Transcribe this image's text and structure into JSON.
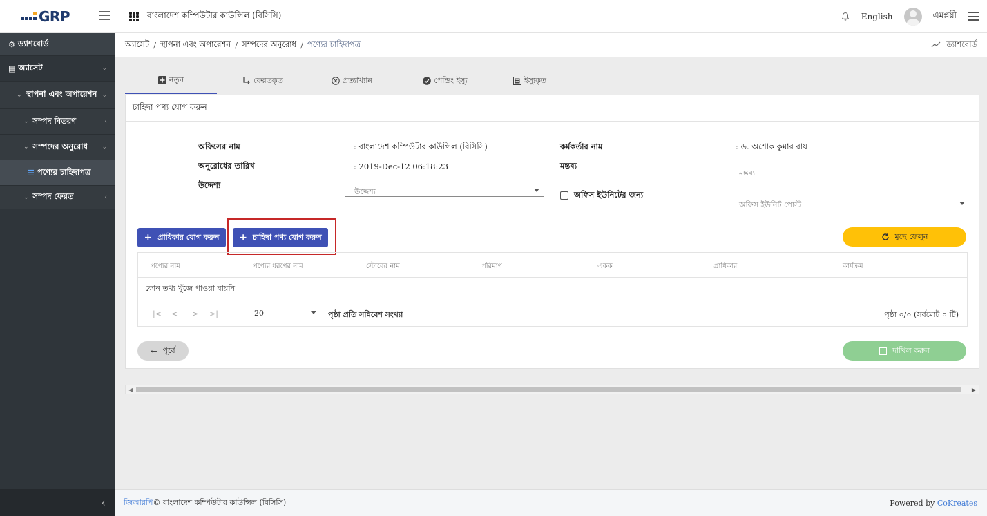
{
  "topbar": {
    "logo_text": "GRP",
    "org_title": "বাংলাদেশ কম্পিউটার কাউন্সিল (বিসিসি)",
    "language": "English",
    "username": "এমপ্লয়ী"
  },
  "sidebar": {
    "dashboard": "ড্যাশবোর্ড",
    "asset": "অ্যাসেট",
    "installation": "স্থাপনা এবং অপারেশন",
    "distribution": "সম্পদ বিতরণ",
    "request": "সম্পদের অনুরোধ",
    "requisition": "পণ্যের চাহিদাপত্র",
    "return": "সম্পদ ফেরত"
  },
  "breadcrumb": {
    "items": [
      "অ্যাসেট",
      "স্থাপনা এবং অপারেশন",
      "সম্পদের অনুরোধ"
    ],
    "current": "পণ্যের চাহিদাপত্র",
    "dashboard_link": "ড্যাশবোর্ড"
  },
  "tabs": [
    {
      "label": "নতুন",
      "icon": "plus-square-icon",
      "active": true
    },
    {
      "label": "ফেরতকৃত",
      "icon": "return-arrow-icon",
      "active": false
    },
    {
      "label": "প্রত্যাখ্যান",
      "icon": "x-circle-icon",
      "active": false
    },
    {
      "label": "পেন্ডিং ইস্যু",
      "icon": "check-circle-icon",
      "active": false
    },
    {
      "label": "ইস্যুকৃত",
      "icon": "document-icon",
      "active": false
    }
  ],
  "card": {
    "header": "চাহিদা পণ্য যোগ করুন"
  },
  "form": {
    "office_name_label": "অফিসের নাম",
    "office_name_value": ": বাংলাদেশ কম্পিউটার কাউন্সিল (বিসিসি)",
    "officer_name_label": "কর্মকর্তার নাম",
    "officer_name_value": ": ড. অশোক কুমার রায়",
    "request_date_label": "অনুরোধের তারিখ",
    "request_date_value": ": 2019-Dec-12 06:18:23",
    "comment_label": "মন্তব্য",
    "comment_placeholder": "মন্তব্য",
    "purpose_label": "উদ্দেশ্য",
    "purpose_placeholder": "উদ্দেশ্য",
    "office_unit_checkbox": "অফিস ইউনিটের জন্য",
    "office_unit_post_placeholder": "অফিস ইউনিট পোস্ট"
  },
  "buttons": {
    "add_priority": "প্রাধিকার যোগ করুন",
    "add_requisition_item": "চাহিদা পণ্য যোগ করুন",
    "clear": "মুছে ফেলুন",
    "previous": "পূর্বে",
    "submit": "দাখিল করুন"
  },
  "table": {
    "columns": [
      "পণ্যের নাম",
      "পণ্যের ধরণের নাম",
      "স্টোরের নাম",
      "পরিমাণ",
      "একক",
      "প্রাধিকার",
      "কার্যক্রম"
    ],
    "empty_message": "কোন তথ্য খুঁজে পাওয়া যায়নি"
  },
  "pager": {
    "page_size": "20",
    "page_size_label": "পৃষ্ঠা প্রতি সন্নিবেশ সংখ্যা",
    "page_info": "পৃষ্ঠা ০/০ (সর্বমোট ০ টি)"
  },
  "footer": {
    "brand": "জিআরপি",
    "copyright": " © বাংলাদেশ কম্পিউটার কাউন্সিল (বিসিসি)",
    "powered_by": "Powered by ",
    "company": "CoKreates"
  },
  "colors": {
    "primary": "#3f51b5",
    "warning": "#ffc107",
    "success_disabled": "#8fcf93",
    "sidebar_bg": "#2f353a",
    "highlight_border": "#c62828"
  }
}
